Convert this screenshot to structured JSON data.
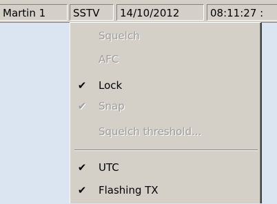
{
  "statusbar": {
    "mode": "Martin 1",
    "type": "SSTV",
    "date": "14/10/2012",
    "time": "08:11:27 :"
  },
  "menu": {
    "squelch": {
      "label": "Squelch",
      "enabled": false,
      "checked": false
    },
    "afc": {
      "label": "AFC",
      "enabled": false,
      "checked": false
    },
    "lock": {
      "label": "Lock",
      "enabled": true,
      "checked": true
    },
    "snap": {
      "label": "Snap",
      "enabled": false,
      "checked": true
    },
    "squelch_threshold": {
      "label": "Squelch threshold...",
      "enabled": false,
      "checked": false
    },
    "utc": {
      "label": "UTC",
      "enabled": true,
      "checked": true
    },
    "flashing_tx": {
      "label": "Flashing TX",
      "enabled": true,
      "checked": true
    },
    "check_icon": "checkmark-icon"
  },
  "colors": {
    "menu_bg": "#d4d0c8",
    "workspace_bg": "#dbe5f1",
    "disabled_text": "#9d9d9d"
  }
}
